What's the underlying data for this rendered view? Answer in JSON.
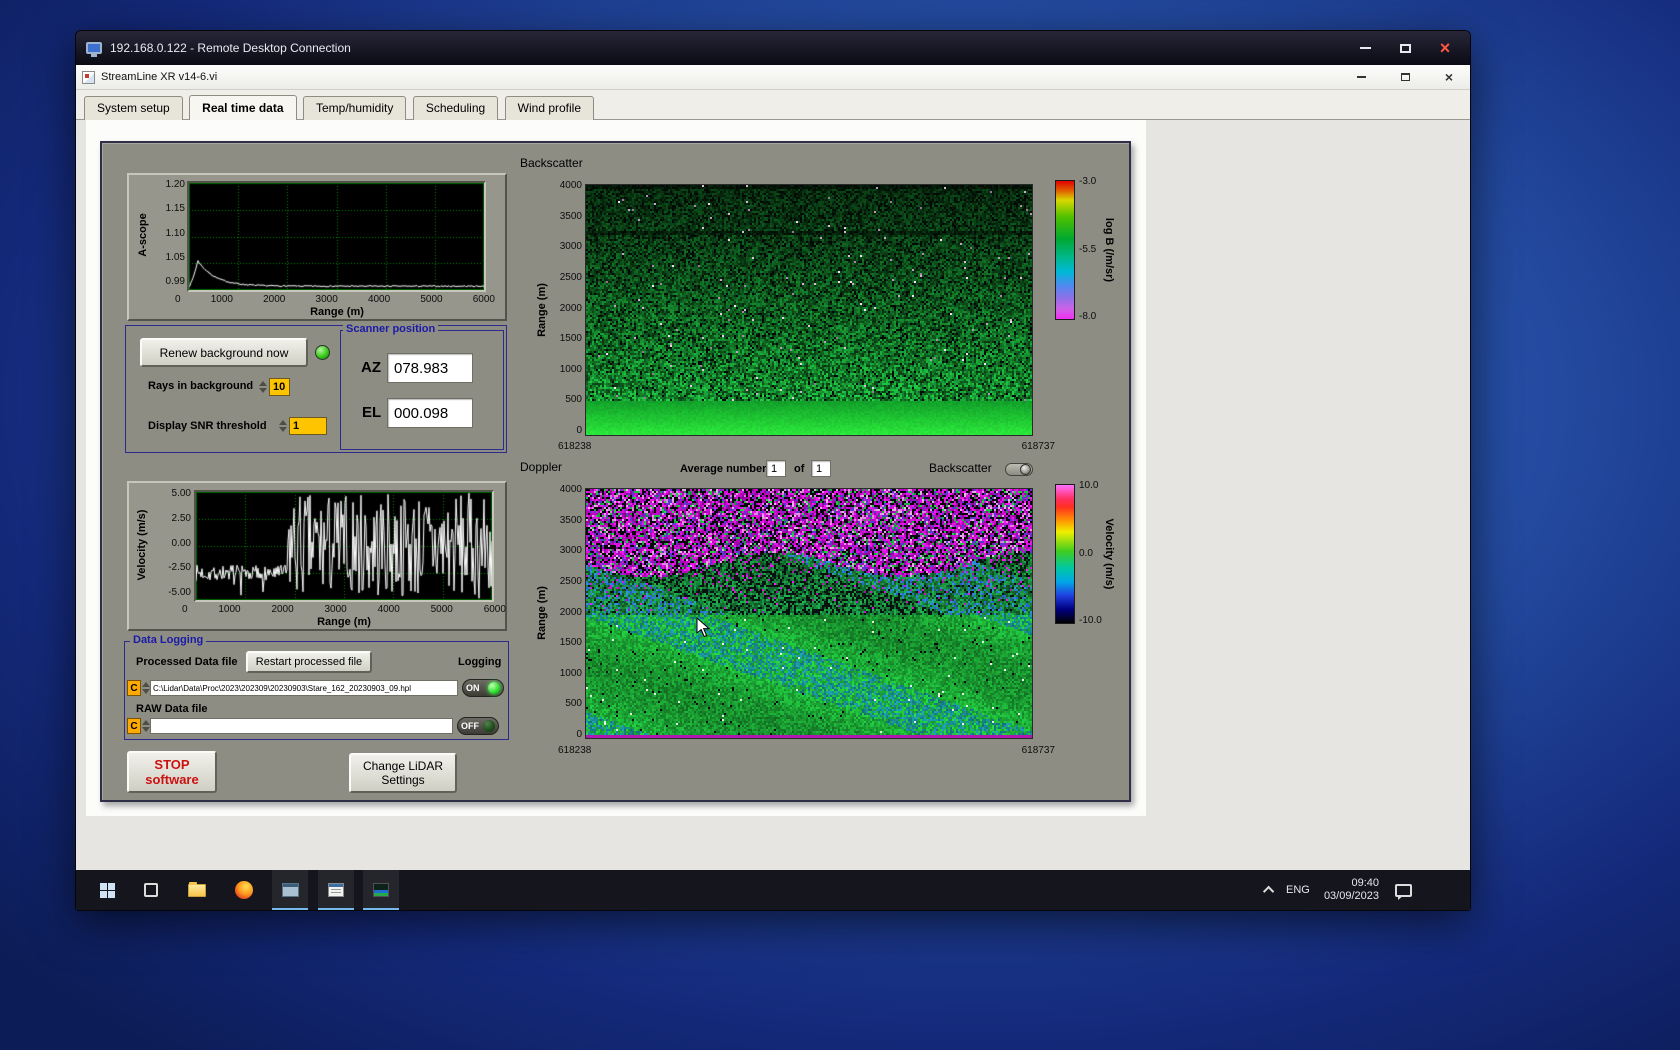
{
  "rdp_window": {
    "title": "192.168.0.122 - Remote Desktop Connection",
    "close_glyph": "×"
  },
  "app_window": {
    "title": "StreamLine XR v14-6.vi",
    "close_glyph": "×",
    "tabs": [
      {
        "label": "System setup"
      },
      {
        "label": "Real time data"
      },
      {
        "label": "Temp/humidity"
      },
      {
        "label": "Scheduling"
      },
      {
        "label": "Wind profile"
      }
    ]
  },
  "panel": {
    "background_controls": {
      "renew_button": "Renew background now",
      "rays_label": "Rays in background",
      "rays_value": "10",
      "snr_label": "Display SNR threshold",
      "snr_value": "1"
    },
    "scanner_position": {
      "title": "Scanner position",
      "az_label": "AZ",
      "az_value": "078.983",
      "el_label": "EL",
      "el_value": "000.098"
    },
    "doppler_header": {
      "average_label": "Average number",
      "average_value": "1",
      "of_label": "of",
      "of_total": "1",
      "toggle_label": "Backscatter"
    },
    "data_logging": {
      "title": "Data Logging",
      "processed_label": "Processed Data file",
      "restart_button": "Restart processed file",
      "logging_label": "Logging",
      "processed_drive": "C",
      "processed_path": "C:\\Lidar\\Data\\Proc\\2023\\202309\\20230903\\Stare_162_20230903_09.hpl",
      "processed_switch": "ON",
      "raw_label": "RAW Data file",
      "raw_drive": "C",
      "raw_path": "",
      "raw_switch": "OFF"
    },
    "stop_button": {
      "line1": "STOP",
      "line2": "software"
    },
    "settings_button": {
      "line1": "Change LiDAR",
      "line2": "Settings"
    }
  },
  "taskbar": {
    "language": "ENG",
    "time": "09:40",
    "date": "03/09/2023"
  },
  "colors": {
    "led_on": "#2ecc2e",
    "logging_on": "#2ecc2e",
    "stop_text": "#cc1111",
    "group_title_blue": "#1b1ba8",
    "panel_gray": "#8d8d84"
  },
  "chart_data": [
    {
      "id": "ascope",
      "type": "line",
      "title": "",
      "xlabel": "Range (m)",
      "ylabel": "A-scope",
      "xlim": [
        0,
        6000
      ],
      "ylim": [
        0.99,
        1.2
      ],
      "grid": [
        6,
        4
      ],
      "grid_color": "#008800",
      "bg": "#000000",
      "x_ticks": [
        "0",
        "1000",
        "2000",
        "3000",
        "4000",
        "5000",
        "6000"
      ],
      "y_ticks": [
        "1.20",
        "1.15",
        "1.10",
        "1.05",
        "0.99"
      ],
      "series": [
        {
          "name": "background A-scope",
          "color": "#ffffff",
          "keypoints": [
            [
              0,
              1.01
            ],
            [
              180,
              1.05
            ],
            [
              600,
              1.016
            ],
            [
              1200,
              1.002
            ],
            [
              2000,
              0.998
            ],
            [
              4000,
              0.998
            ],
            [
              6000,
              0.998
            ]
          ]
        }
      ]
    },
    {
      "id": "backscatter",
      "type": "heatmap",
      "title": "Backscatter",
      "xlabel": "",
      "ylabel": "Range (m)",
      "x_ticks": [
        "618238",
        "618737"
      ],
      "y_ticks": [
        "4000",
        "3500",
        "3000",
        "2500",
        "2000",
        "1500",
        "1000",
        "500",
        "0"
      ],
      "ylim": [
        0,
        4000
      ],
      "colorbar": {
        "label": "log B (/m/sr)",
        "ticks": [
          "-3.0",
          "-5.5",
          "-8.0"
        ],
        "stops": [
          "#e00000 0%",
          "#e06000 7%",
          "#d8d800 14%",
          "#50c000 26%",
          "#00a830 42%",
          "#00b890 56%",
          "#00b8d8 66%",
          "#5088f0 76%",
          "#9070e8 85%",
          "#d060e8 93%",
          "#f030f0 100%"
        ]
      },
      "description": "Attenuated backscatter time-height display: strong bright-green returns below ~500 m fading upward into speckled green/black noise toward 4000 m"
    },
    {
      "id": "velocity",
      "type": "line",
      "title": "",
      "xlabel": "Range (m)",
      "ylabel": "Velocity (m/s)",
      "xlim": [
        0,
        6000
      ],
      "ylim": [
        -5,
        5
      ],
      "grid": [
        6,
        4
      ],
      "grid_color": "#008800",
      "bg": "#000000",
      "x_ticks": [
        "0",
        "1000",
        "2000",
        "3000",
        "4000",
        "5000",
        "6000"
      ],
      "y_ticks": [
        "5.00",
        "2.50",
        "0.00",
        "-2.50",
        "-5.00"
      ],
      "series": [
        {
          "name": "radial velocity",
          "color": "#ffffff",
          "description": "coherent trace near -2.5 m/s out to ~1800 m, then uncorrelated noise spanning the full ±5 m/s scale to 6000 m"
        }
      ]
    },
    {
      "id": "doppler",
      "type": "heatmap",
      "title": "Doppler",
      "xlabel": "",
      "ylabel": "Range (m)",
      "x_ticks": [
        "618238",
        "618737"
      ],
      "y_ticks": [
        "4000",
        "3500",
        "3000",
        "2500",
        "2000",
        "1500",
        "1000",
        "500",
        "0"
      ],
      "ylim": [
        0,
        4000
      ],
      "colorbar": {
        "label": "Velocity (m/s)",
        "ticks": [
          "10.0",
          "0.0",
          "-10.0"
        ],
        "stops": [
          "#ff70ff 0%",
          "#ff3060 10%",
          "#ff3020 16%",
          "#ff9800 26%",
          "#f0f000 34%",
          "#40cc20 48%",
          "#00c8a0 60%",
          "#00a8e8 70%",
          "#2040e0 80%",
          "#000080 90%",
          "#000000 100%"
        ]
      },
      "description": "Radial velocity time-height display: coherent green/blue velocities below ~2000 m with diagonal streaks, random magenta/black noise above"
    }
  ]
}
